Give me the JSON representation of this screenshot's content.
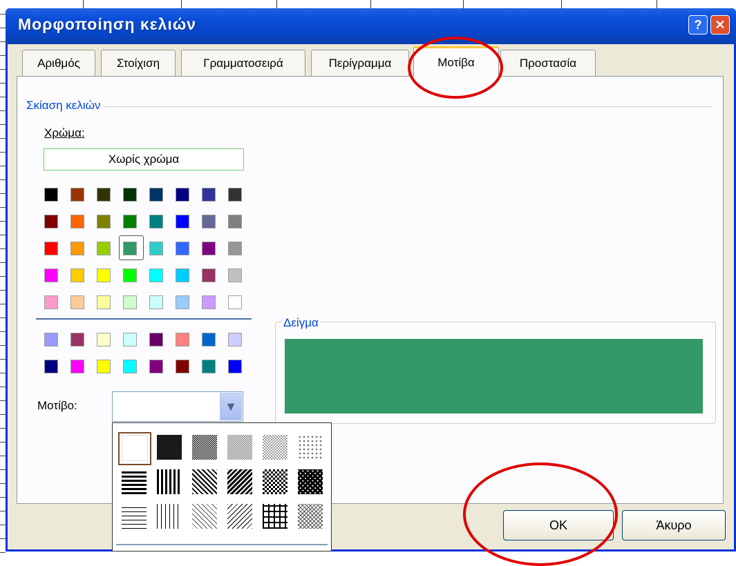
{
  "dialog": {
    "title": "Μορφοποίηση κελιών",
    "help_glyph": "?",
    "close_glyph": "✕"
  },
  "tabs": [
    {
      "label": "Αριθμός",
      "active": false
    },
    {
      "label": "Στοίχιση",
      "active": false
    },
    {
      "label": "Γραμματοσειρά",
      "active": false
    },
    {
      "label": "Περίγραμμα",
      "active": false
    },
    {
      "label": "Μοτίβα",
      "active": true
    },
    {
      "label": "Προστασία",
      "active": false
    }
  ],
  "shading": {
    "group_label": "Σκίαση κελιών",
    "color_label": "Χρώμα:",
    "no_color_button": "Χωρίς χρώμα",
    "selected_color": "#339966",
    "palette_main": [
      [
        "#000000",
        "#993300",
        "#333300",
        "#003300",
        "#003366",
        "#000080",
        "#333399",
        "#333333"
      ],
      [
        "#800000",
        "#FF6600",
        "#808000",
        "#008000",
        "#008080",
        "#0000FF",
        "#666699",
        "#808080"
      ],
      [
        "#FF0000",
        "#FF9900",
        "#99CC00",
        "#339966",
        "#33CCCC",
        "#3366FF",
        "#800080",
        "#969696"
      ],
      [
        "#FF00FF",
        "#FFCC00",
        "#FFFF00",
        "#00FF00",
        "#00FFFF",
        "#00CCFF",
        "#993366",
        "#C0C0C0"
      ],
      [
        "#FF99CC",
        "#FFCC99",
        "#FFFF99",
        "#CCFFCC",
        "#CCFFFF",
        "#99CCFF",
        "#CC99FF",
        "#FFFFFF"
      ]
    ],
    "palette_extra": [
      [
        "#9999FF",
        "#993366",
        "#FFFFCC",
        "#CCFFFF",
        "#660066",
        "#FF8080",
        "#0066CC",
        "#CCCCFF"
      ],
      [
        "#000080",
        "#FF00FF",
        "#FFFF00",
        "#00FFFF",
        "#800080",
        "#800000",
        "#008080",
        "#0000FF"
      ]
    ],
    "pattern_label": "Μοτίβο:",
    "pattern_selected": "solid",
    "pattern_options": [
      [
        "solid",
        "75-gray",
        "50-gray",
        "25-gray",
        "12-gray",
        "6-gray"
      ],
      [
        "thick-horizontal",
        "thick-vertical",
        "thick-reverse-diagonal",
        "thick-diagonal",
        "thick-diagonal-crosshatch",
        "thick-diagonal-crosshatch-heavy"
      ],
      [
        "thin-horizontal",
        "thin-vertical",
        "thin-reverse-diagonal",
        "thin-diagonal",
        "thin-horizontal-crosshatch",
        "thin-diagonal-crosshatch"
      ]
    ]
  },
  "sample": {
    "label": "Δείγμα",
    "fill_color": "#339966"
  },
  "buttons": {
    "ok": "OK",
    "cancel": "Άκυρο"
  },
  "annotation_color": "#e00000"
}
